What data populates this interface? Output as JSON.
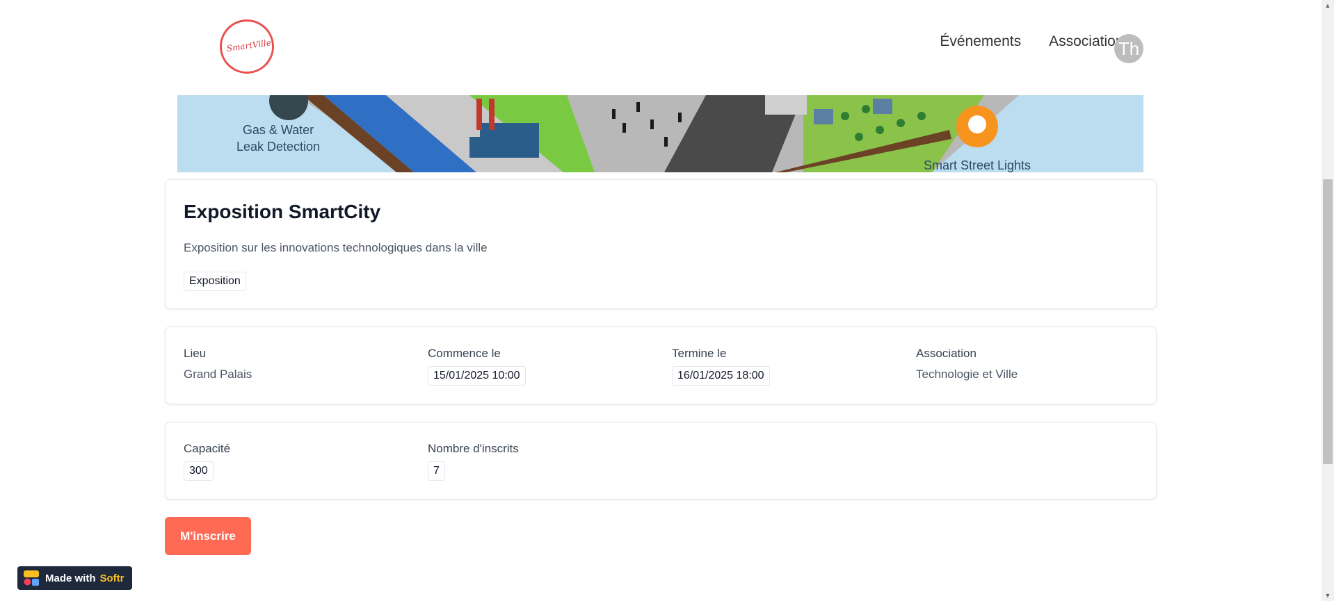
{
  "header": {
    "logo_text": "SmartVille",
    "nav": [
      {
        "label": "Événements"
      },
      {
        "label": "Associations"
      }
    ],
    "avatar_initials": "Th"
  },
  "banner": {
    "left_caption_line1": "Gas & Water",
    "left_caption_line2": "Leak Detection",
    "right_caption": "Smart Street Lights"
  },
  "event": {
    "title": "Exposition SmartCity",
    "description": "Exposition sur les innovations technologiques dans la ville",
    "tag": "Exposition"
  },
  "details": {
    "lieu_label": "Lieu",
    "lieu_value": "Grand Palais",
    "start_label": "Commence le",
    "start_value": "15/01/2025 10:00",
    "end_label": "Termine le",
    "end_value": "16/01/2025 18:00",
    "association_label": "Association",
    "association_value": "Technologie et Ville"
  },
  "stats": {
    "capacity_label": "Capacité",
    "capacity_value": "300",
    "registered_label": "Nombre d'inscrits",
    "registered_value": "7"
  },
  "actions": {
    "register_label": "M'inscrire"
  },
  "badge": {
    "made_with": "Made with",
    "brand": "Softr"
  },
  "colors": {
    "accent": "#ff6a55",
    "logo": "#e9504f",
    "badge_bg": "#1e2a3c"
  }
}
